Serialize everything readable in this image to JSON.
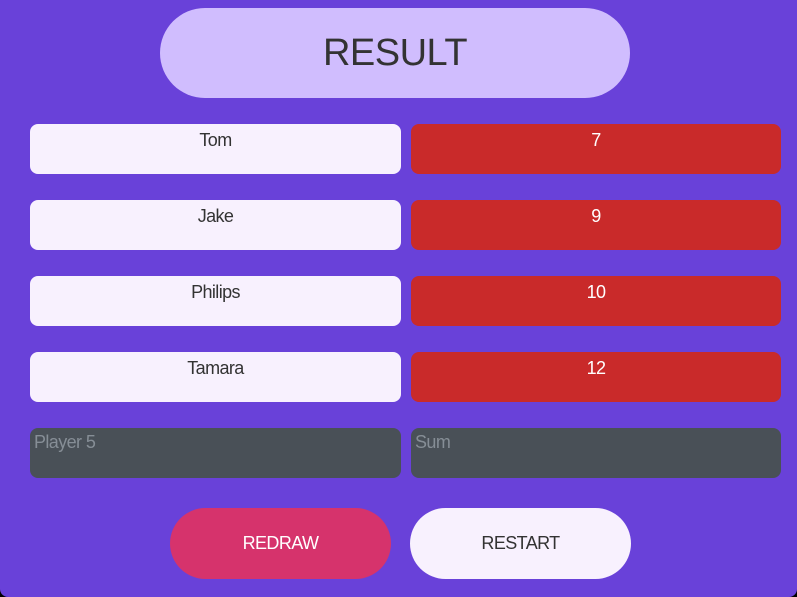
{
  "title": "RESULT",
  "players": [
    {
      "name": "Tom",
      "score": "7"
    },
    {
      "name": "Jake",
      "score": "9"
    },
    {
      "name": "Philips",
      "score": "10"
    },
    {
      "name": "Tamara",
      "score": "12"
    }
  ],
  "inputs": {
    "player_placeholder": "Player 5",
    "sum_placeholder": "Sum"
  },
  "buttons": {
    "redraw": "REDRAW",
    "restart": "RESTART"
  }
}
